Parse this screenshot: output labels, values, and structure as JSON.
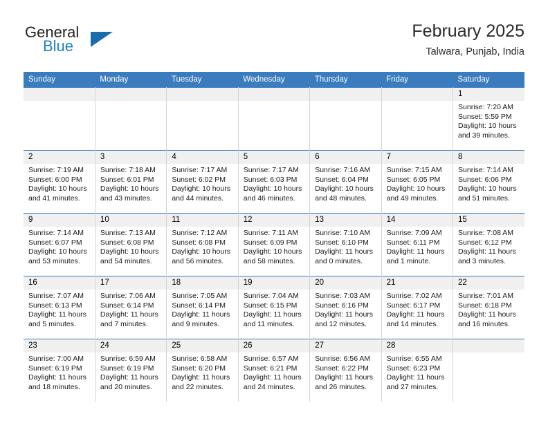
{
  "brand": {
    "name_part1": "General",
    "name_part2": "Blue",
    "logo_icon": "blue-triangle-icon"
  },
  "header": {
    "title": "February 2025",
    "subtitle": "Talwara, Punjab, India"
  },
  "colors": {
    "header_blue": "#3a7cbe",
    "brand_blue": "#1f7fc4",
    "daynum_bg": "#f0f0f0",
    "cell_border": "#d4d4d4"
  },
  "calendar": {
    "weekday_headers": [
      "Sunday",
      "Monday",
      "Tuesday",
      "Wednesday",
      "Thursday",
      "Friday",
      "Saturday"
    ],
    "labels": {
      "sunrise": "Sunrise:",
      "sunset": "Sunset:",
      "daylight": "Daylight:"
    },
    "weeks": [
      [
        {
          "day": "",
          "empty": true
        },
        {
          "day": "",
          "empty": true
        },
        {
          "day": "",
          "empty": true
        },
        {
          "day": "",
          "empty": true
        },
        {
          "day": "",
          "empty": true
        },
        {
          "day": "",
          "empty": true
        },
        {
          "day": "1",
          "sunrise": "Sunrise: 7:20 AM",
          "sunset": "Sunset: 5:59 PM",
          "daylight1": "Daylight: 10 hours",
          "daylight2": "and 39 minutes."
        }
      ],
      [
        {
          "day": "2",
          "sunrise": "Sunrise: 7:19 AM",
          "sunset": "Sunset: 6:00 PM",
          "daylight1": "Daylight: 10 hours",
          "daylight2": "and 41 minutes."
        },
        {
          "day": "3",
          "sunrise": "Sunrise: 7:18 AM",
          "sunset": "Sunset: 6:01 PM",
          "daylight1": "Daylight: 10 hours",
          "daylight2": "and 43 minutes."
        },
        {
          "day": "4",
          "sunrise": "Sunrise: 7:17 AM",
          "sunset": "Sunset: 6:02 PM",
          "daylight1": "Daylight: 10 hours",
          "daylight2": "and 44 minutes."
        },
        {
          "day": "5",
          "sunrise": "Sunrise: 7:17 AM",
          "sunset": "Sunset: 6:03 PM",
          "daylight1": "Daylight: 10 hours",
          "daylight2": "and 46 minutes."
        },
        {
          "day": "6",
          "sunrise": "Sunrise: 7:16 AM",
          "sunset": "Sunset: 6:04 PM",
          "daylight1": "Daylight: 10 hours",
          "daylight2": "and 48 minutes."
        },
        {
          "day": "7",
          "sunrise": "Sunrise: 7:15 AM",
          "sunset": "Sunset: 6:05 PM",
          "daylight1": "Daylight: 10 hours",
          "daylight2": "and 49 minutes."
        },
        {
          "day": "8",
          "sunrise": "Sunrise: 7:14 AM",
          "sunset": "Sunset: 6:06 PM",
          "daylight1": "Daylight: 10 hours",
          "daylight2": "and 51 minutes."
        }
      ],
      [
        {
          "day": "9",
          "sunrise": "Sunrise: 7:14 AM",
          "sunset": "Sunset: 6:07 PM",
          "daylight1": "Daylight: 10 hours",
          "daylight2": "and 53 minutes."
        },
        {
          "day": "10",
          "sunrise": "Sunrise: 7:13 AM",
          "sunset": "Sunset: 6:08 PM",
          "daylight1": "Daylight: 10 hours",
          "daylight2": "and 54 minutes."
        },
        {
          "day": "11",
          "sunrise": "Sunrise: 7:12 AM",
          "sunset": "Sunset: 6:08 PM",
          "daylight1": "Daylight: 10 hours",
          "daylight2": "and 56 minutes."
        },
        {
          "day": "12",
          "sunrise": "Sunrise: 7:11 AM",
          "sunset": "Sunset: 6:09 PM",
          "daylight1": "Daylight: 10 hours",
          "daylight2": "and 58 minutes."
        },
        {
          "day": "13",
          "sunrise": "Sunrise: 7:10 AM",
          "sunset": "Sunset: 6:10 PM",
          "daylight1": "Daylight: 11 hours",
          "daylight2": "and 0 minutes."
        },
        {
          "day": "14",
          "sunrise": "Sunrise: 7:09 AM",
          "sunset": "Sunset: 6:11 PM",
          "daylight1": "Daylight: 11 hours",
          "daylight2": "and 1 minute."
        },
        {
          "day": "15",
          "sunrise": "Sunrise: 7:08 AM",
          "sunset": "Sunset: 6:12 PM",
          "daylight1": "Daylight: 11 hours",
          "daylight2": "and 3 minutes."
        }
      ],
      [
        {
          "day": "16",
          "sunrise": "Sunrise: 7:07 AM",
          "sunset": "Sunset: 6:13 PM",
          "daylight1": "Daylight: 11 hours",
          "daylight2": "and 5 minutes."
        },
        {
          "day": "17",
          "sunrise": "Sunrise: 7:06 AM",
          "sunset": "Sunset: 6:14 PM",
          "daylight1": "Daylight: 11 hours",
          "daylight2": "and 7 minutes."
        },
        {
          "day": "18",
          "sunrise": "Sunrise: 7:05 AM",
          "sunset": "Sunset: 6:14 PM",
          "daylight1": "Daylight: 11 hours",
          "daylight2": "and 9 minutes."
        },
        {
          "day": "19",
          "sunrise": "Sunrise: 7:04 AM",
          "sunset": "Sunset: 6:15 PM",
          "daylight1": "Daylight: 11 hours",
          "daylight2": "and 11 minutes."
        },
        {
          "day": "20",
          "sunrise": "Sunrise: 7:03 AM",
          "sunset": "Sunset: 6:16 PM",
          "daylight1": "Daylight: 11 hours",
          "daylight2": "and 12 minutes."
        },
        {
          "day": "21",
          "sunrise": "Sunrise: 7:02 AM",
          "sunset": "Sunset: 6:17 PM",
          "daylight1": "Daylight: 11 hours",
          "daylight2": "and 14 minutes."
        },
        {
          "day": "22",
          "sunrise": "Sunrise: 7:01 AM",
          "sunset": "Sunset: 6:18 PM",
          "daylight1": "Daylight: 11 hours",
          "daylight2": "and 16 minutes."
        }
      ],
      [
        {
          "day": "23",
          "sunrise": "Sunrise: 7:00 AM",
          "sunset": "Sunset: 6:19 PM",
          "daylight1": "Daylight: 11 hours",
          "daylight2": "and 18 minutes."
        },
        {
          "day": "24",
          "sunrise": "Sunrise: 6:59 AM",
          "sunset": "Sunset: 6:19 PM",
          "daylight1": "Daylight: 11 hours",
          "daylight2": "and 20 minutes."
        },
        {
          "day": "25",
          "sunrise": "Sunrise: 6:58 AM",
          "sunset": "Sunset: 6:20 PM",
          "daylight1": "Daylight: 11 hours",
          "daylight2": "and 22 minutes."
        },
        {
          "day": "26",
          "sunrise": "Sunrise: 6:57 AM",
          "sunset": "Sunset: 6:21 PM",
          "daylight1": "Daylight: 11 hours",
          "daylight2": "and 24 minutes."
        },
        {
          "day": "27",
          "sunrise": "Sunrise: 6:56 AM",
          "sunset": "Sunset: 6:22 PM",
          "daylight1": "Daylight: 11 hours",
          "daylight2": "and 26 minutes."
        },
        {
          "day": "28",
          "sunrise": "Sunrise: 6:55 AM",
          "sunset": "Sunset: 6:23 PM",
          "daylight1": "Daylight: 11 hours",
          "daylight2": "and 27 minutes."
        },
        {
          "day": "",
          "empty": true
        }
      ]
    ]
  }
}
